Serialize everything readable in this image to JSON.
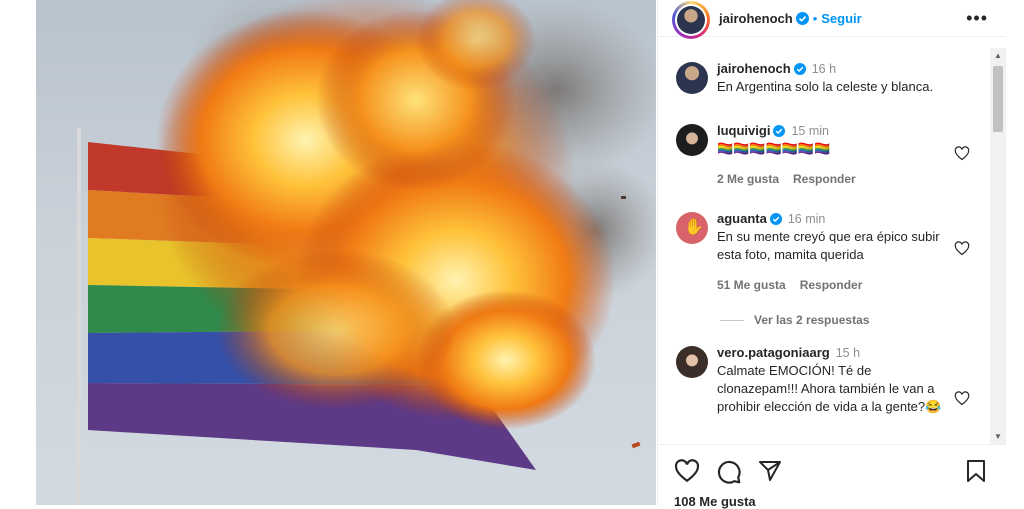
{
  "header": {
    "username": "jairohenoch",
    "separator": "•",
    "follow_label": "Seguir",
    "more_label": "•••"
  },
  "comments": [
    {
      "username": "jairohenoch",
      "time": "16 h",
      "text": "En Argentina solo la celeste y blanca."
    },
    {
      "username": "luquivigi",
      "time": "15 min",
      "text": "🏳️‍🌈🏳️‍🌈🏳️‍🌈🏳️‍🌈🏳️‍🌈🏳️‍🌈🏳️‍🌈",
      "likes": "2 Me gusta",
      "reply": "Responder"
    },
    {
      "username": "aguanta",
      "time": "16 min",
      "text": "En su mente creyó que era épico subir esta foto, mamita querida",
      "likes": "51 Me gusta",
      "reply": "Responder"
    },
    {
      "username": "vero.patagoniaarg",
      "time": "15 h",
      "text": "Calmate EMOCIÓN! Té de clonazepam!!! Ahora también le van a prohibir elección de vida a la gente?😂"
    }
  ],
  "view_replies": "Ver las 2 respuestas",
  "post": {
    "likes": "108 Me gusta"
  },
  "colors": {
    "accent": "#0095f6",
    "verified": "#0095f6"
  }
}
